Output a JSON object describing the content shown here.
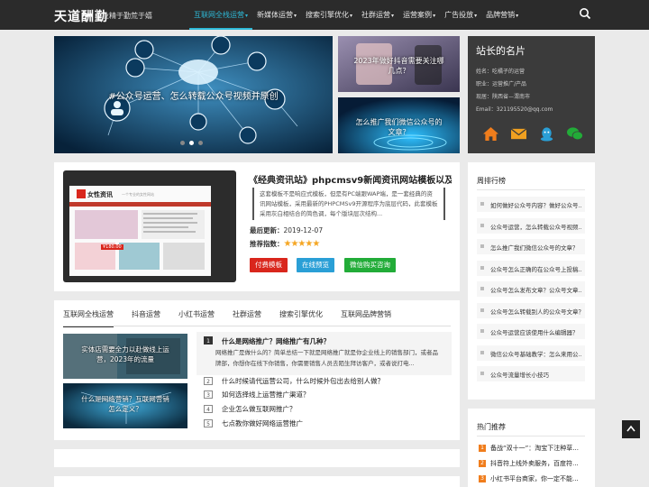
{
  "nav": {
    "logo": "天道酬勤",
    "slogan": "业精于勤荒于嬉",
    "items": [
      {
        "label": "互联网全栈运营",
        "active": true,
        "caret": true
      },
      {
        "label": "新媒体运营",
        "caret": true
      },
      {
        "label": "搜索引擎优化",
        "caret": true
      },
      {
        "label": "社群运营",
        "caret": true
      },
      {
        "label": "运营案例",
        "caret": true
      },
      {
        "label": "广告投放",
        "caret": true
      },
      {
        "label": "品牌营销",
        "caret": true
      }
    ],
    "caret_glyph": "▾"
  },
  "banner": {
    "caption": "#公众号运营、怎么转载公众号视频并原创",
    "side": [
      {
        "caption": "2023年做好抖音需要关注哪\n几点？"
      },
      {
        "caption": "怎么推广我们微信公众号的\n文章？"
      }
    ]
  },
  "profile": {
    "title": "站长的名片",
    "lines": [
      "姓名：吃橘子的运营",
      "职业：运营推广/产品",
      "现居：陕西省—渭南市",
      "Email：321195520@qq.com"
    ],
    "social": [
      "home-icon",
      "mail-icon",
      "qq-icon",
      "wechat-icon"
    ]
  },
  "theme": {
    "title": "《经典资讯站》phpcmsv9新闻资讯网站模板以及源码...",
    "desc": "这套模板不是响应式模板，但是有PC端跟WAP端，是一套经典的资讯网站模板，采用最新的PHPCMSv9开源程序为底层代码，此套模板采用灰白相结合的简色调，每个版块层次结构...",
    "updated_label": "最后更新：",
    "updated_value": "2019-12-07",
    "rating_label": "推荐指数：",
    "stars": "★★★★★",
    "rating": 5,
    "buttons": [
      {
        "label": "付费模板",
        "color": "#d9261c"
      },
      {
        "label": "在线预览",
        "color": "#2a9fd6"
      },
      {
        "label": "微信购买咨询",
        "color": "#22ac38"
      }
    ],
    "thumb": {
      "brand": "女性资讯",
      "tagline": "一个专业的女性网站",
      "price": "¥180.00"
    }
  },
  "tabs": [
    "互联网全栈运营",
    "抖音运营",
    "小红书运营",
    "社群运营",
    "搜索引擎优化",
    "互联网品牌营销"
  ],
  "mini": [
    {
      "caption": "实体店需要全力以赴做线上运\n营，2023年的流量"
    },
    {
      "caption": "什么是网络营销？互联网营销\n怎么定义？"
    }
  ],
  "featured": {
    "num": "1",
    "title": "什么是网络推广？网络推广有几种？",
    "desc": "网络推广是做什么的？简单总结一下就是网络推广就是你企业线上的销售部门，或者品牌部，你想你在线下你销售，你需要销售人员去陌生拜访客户，或者说打电..."
  },
  "list": [
    {
      "num": "2",
      "text": "什么时候请代运营公司，什么时候外包出去给别人做？"
    },
    {
      "num": "3",
      "text": "如何选择线上运营推广渠道？"
    },
    {
      "num": "4",
      "text": "企业怎么做互联网推广？"
    },
    {
      "num": "5",
      "text": "七点教你做好网络运营推广"
    }
  ],
  "sidebar": {
    "weekly_title": "周排行榜",
    "weekly": [
      "如何做好公众号内容？做好公众号...",
      "公众号运营，怎么转载公众号视频...",
      "怎么推广我们微信公众号的文章？",
      "公众号怎么正确的在公众号上投稿...",
      "公众号怎么发布文章？公众号文章...",
      "公众号怎么转载别人的公众号文章？",
      "公众号运营应该使用什么编辑器？",
      "微信公众号基础教学：怎么来用公...",
      "公众号流量增长小技巧"
    ],
    "hot_title": "热门推荐",
    "hot": [
      {
        "num": "1",
        "text": "备战“双十一”：淘宝下注种草..."
      },
      {
        "num": "2",
        "text": "抖音符上线外卖服务，百度符..."
      },
      {
        "num": "3",
        "text": "小红书平台商家，你一定不能..."
      }
    ]
  }
}
